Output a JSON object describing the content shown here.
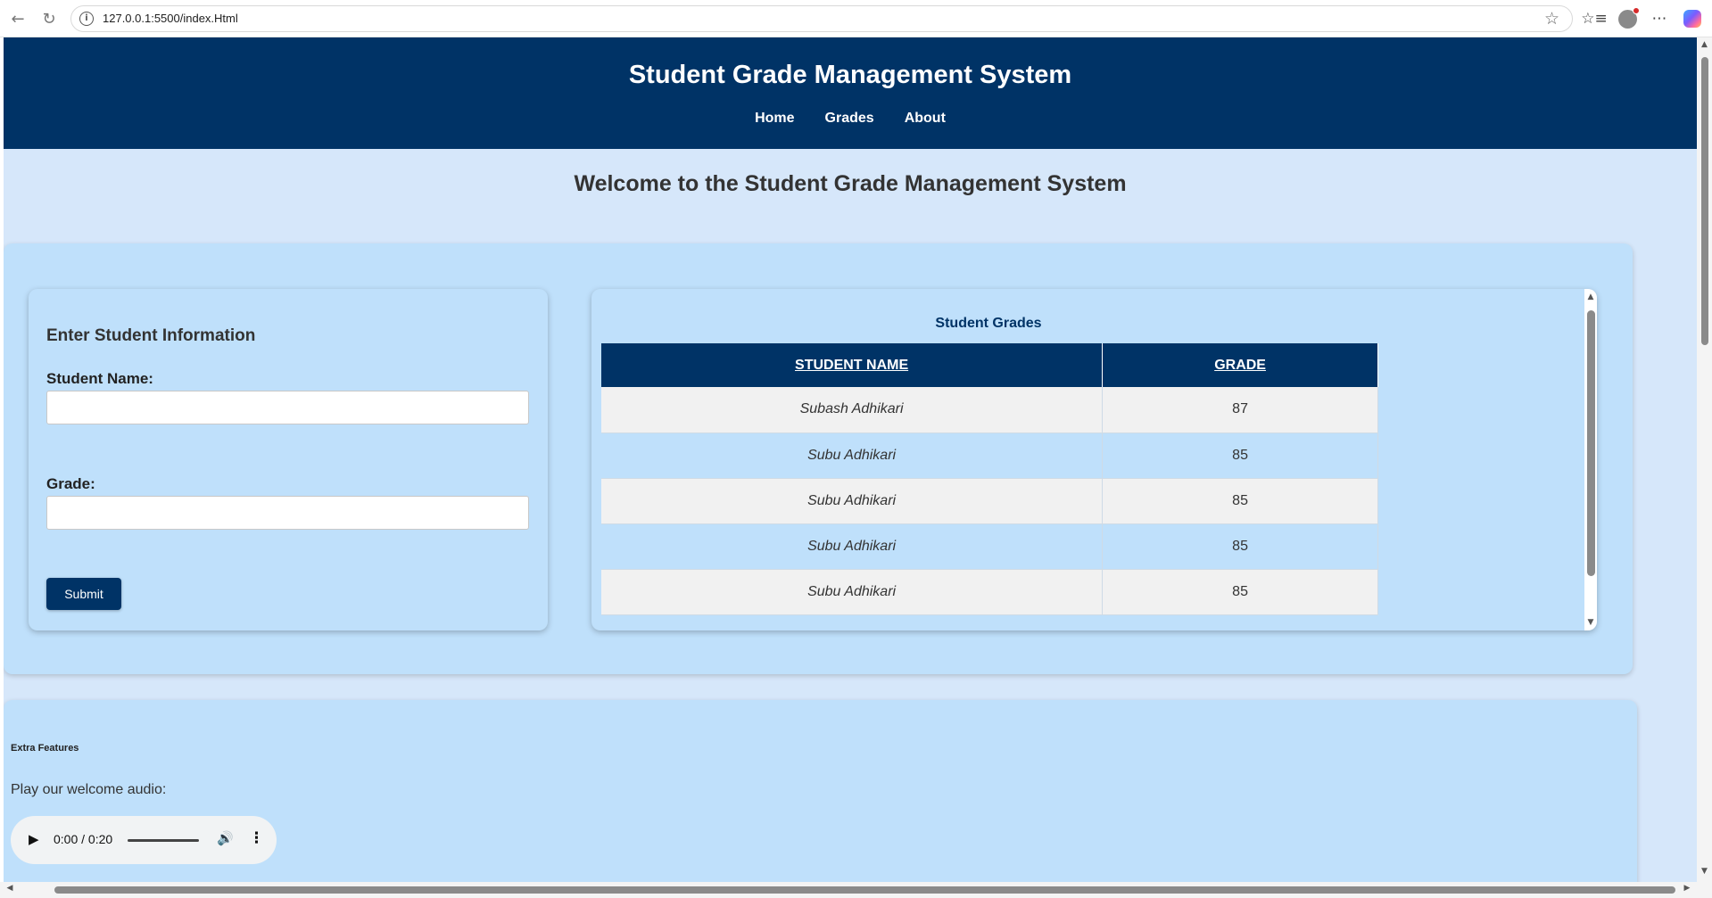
{
  "browser": {
    "url": "127.0.0.1:5500/index.Html",
    "icons": [
      "back-arrow-icon",
      "refresh-icon",
      "site-info-icon",
      "favorite-star-icon",
      "favorites-list-icon",
      "profile-avatar-icon",
      "more-menu-icon",
      "copilot-icon"
    ]
  },
  "header": {
    "title": "Student Grade Management System",
    "nav": [
      "Home",
      "Grades",
      "About"
    ],
    "bg_color": "#003366"
  },
  "welcome": "Welcome to the Student Grade Management System",
  "form": {
    "heading": "Enter Student Information",
    "name_label": "Student Name:",
    "name_value": "",
    "grade_label": "Grade:",
    "grade_value": "",
    "submit_label": "Submit"
  },
  "grades": {
    "title": "Student Grades",
    "columns": [
      "STUDENT NAME",
      "GRADE"
    ],
    "rows": [
      {
        "name": "Subash Adhikari",
        "grade": "87"
      },
      {
        "name": "Subu Adhikari",
        "grade": "85"
      },
      {
        "name": "Subu Adhikari",
        "grade": "85"
      },
      {
        "name": "Subu Adhikari",
        "grade": "85"
      },
      {
        "name": "Subu Adhikari",
        "grade": "85"
      }
    ]
  },
  "extra": {
    "title": "Extra Features",
    "audio_text": "Play our welcome audio:",
    "audio_time": "0:00 / 0:20"
  }
}
